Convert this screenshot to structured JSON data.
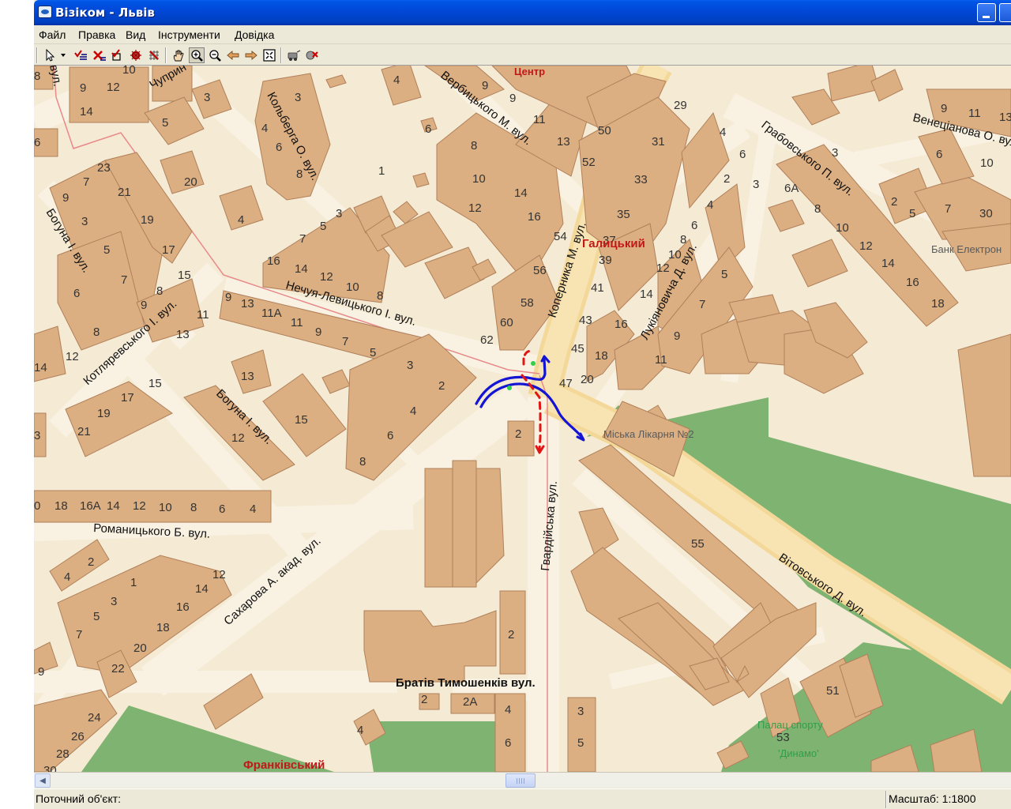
{
  "window": {
    "title": "Візіком - Львів"
  },
  "menu": [
    "Файл",
    "Правка",
    "Вид",
    "Інструменти",
    "Довідка"
  ],
  "toolbar": {
    "icons": [
      "pointer-icon",
      "dropdown-arrow-icon",
      "select-list-icon",
      "clear-selection-icon",
      "select-object-icon",
      "gear-icon",
      "grid-select-icon",
      "hand-icon",
      "zoom-in-icon",
      "zoom-out-icon",
      "back-arrow-icon",
      "forward-arrow-icon",
      "full-extent-icon",
      "route-icon",
      "route-settings-icon"
    ]
  },
  "map": {
    "streets": [
      {
        "text": "Вербицького М. вул."
      },
      {
        "text": "Кольберга О. вул."
      },
      {
        "text": "Чуприн"
      },
      {
        "text": "Грабовського П. вул."
      },
      {
        "text": "Венеціанова О. вул"
      },
      {
        "text": "Богуна І. вул."
      },
      {
        "text": "Коперника М. вул."
      },
      {
        "text": "Нечуя-Левицького І. вул."
      },
      {
        "text": "Котляревського І. вул."
      },
      {
        "text": "Лукіяновича Д. вул."
      },
      {
        "text": "Богуна І. вул."
      },
      {
        "text": "Романицького Б. вул."
      },
      {
        "text": "Гвардійська вул."
      },
      {
        "text": "Вітовського Д. вул."
      },
      {
        "text": "Сахарова А. акад. вул."
      },
      {
        "text": "Братів Тимошенків вул."
      },
      {
        "text": "вул."
      }
    ],
    "districts": [
      "Центр",
      "Галицький",
      "Франківський"
    ],
    "pois": [
      {
        "text": "Міська Лікарня №2"
      },
      {
        "text": "Банк Електрон"
      },
      {
        "text": "Палац спорту"
      },
      {
        "text": "'Динамо'"
      }
    ]
  },
  "status": {
    "current_object": "Поточний об'єкт:",
    "scale": "Масштаб: 1:1800"
  }
}
